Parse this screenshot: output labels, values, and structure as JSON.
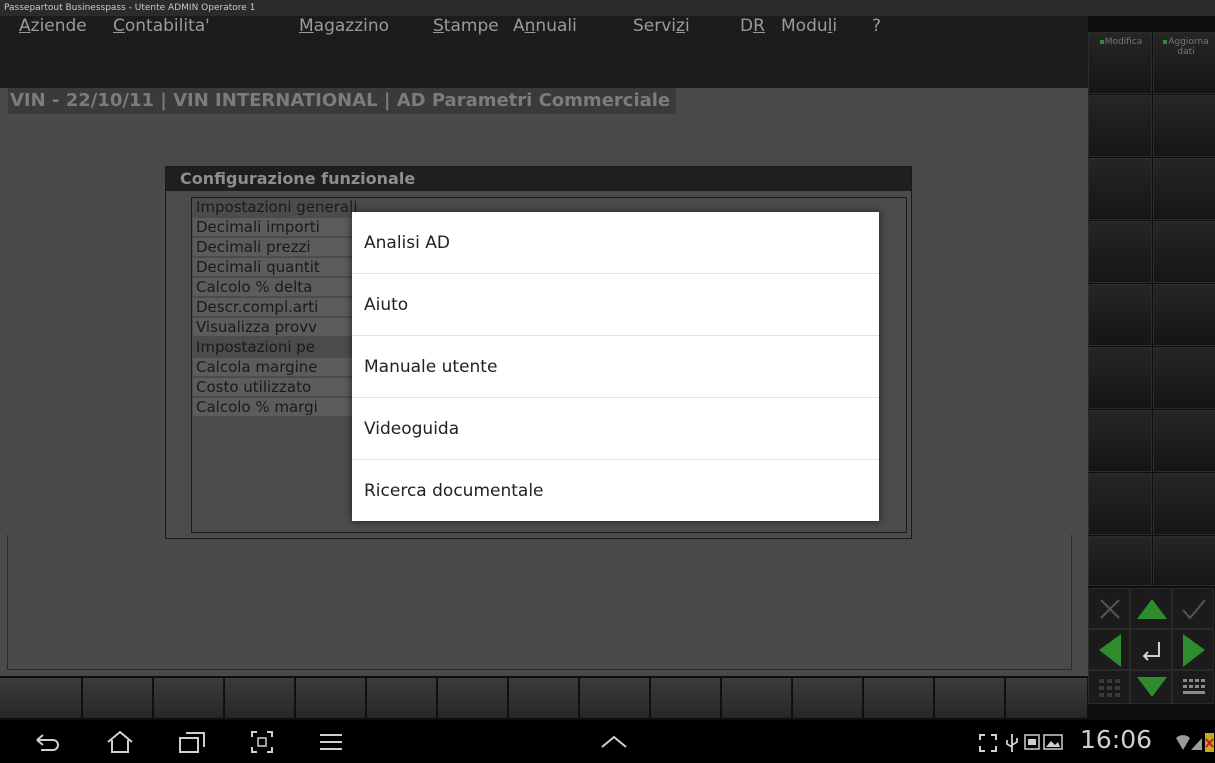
{
  "window": {
    "title": "Passepartout Businesspass - Utente ADMIN Operatore 1"
  },
  "menubar": {
    "items": [
      {
        "label": "Aziende",
        "mnemonic": "A"
      },
      {
        "label": "Contabilita'",
        "mnemonic": "C"
      },
      {
        "label": "Magazzino",
        "mnemonic": "M"
      },
      {
        "label": "Stampe",
        "mnemonic": "S"
      },
      {
        "label": "Annuali",
        "mnemonic": "n"
      },
      {
        "label": "Servizi",
        "mnemonic": "z"
      },
      {
        "label": "DR",
        "mnemonic": "R"
      },
      {
        "label": "Moduli",
        "mnemonic": "l"
      },
      {
        "label": "?",
        "mnemonic": ""
      }
    ]
  },
  "breadcrumb": "VIN - 22/10/11 | VIN INTERNATIONAL  | AD Parametri Commerciale",
  "config_panel": {
    "title": "Configurazione funzionale",
    "rows": [
      "Impostazioni generali",
      "Decimali importi",
      "Decimali prezzi",
      "Decimali quantit",
      "Calcolo % delta",
      "Descr.compl.arti",
      "Visualizza provv",
      "Impostazioni pe",
      "Calcola margine",
      "Costo utilizzato",
      "Calcolo % margi"
    ]
  },
  "popup_menu": {
    "items": [
      "Analisi AD",
      "Aiuto",
      "Manuale utente",
      "Videoguida",
      "Ricerca documentale"
    ]
  },
  "sidebar": {
    "buttons": [
      {
        "label": "Modifica"
      },
      {
        "label": "Aggiorna dati"
      }
    ]
  },
  "status_bar": {
    "time": "16:06"
  },
  "colors": {
    "accent_green": "#2e8b2e",
    "popup_background": "#ffffff"
  }
}
